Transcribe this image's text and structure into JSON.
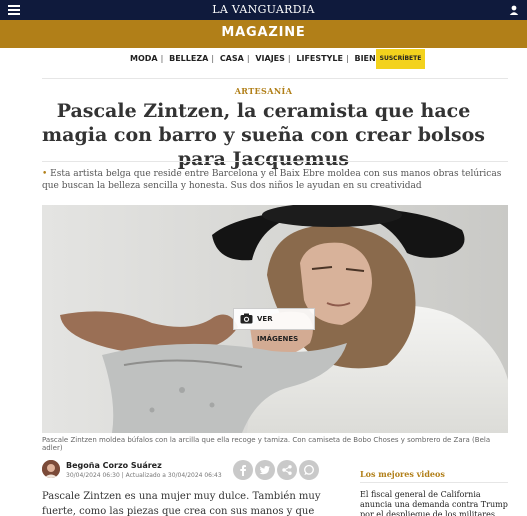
{
  "header": {
    "brand": "LA VANGUARDIA",
    "section_title": "MAGAZINE"
  },
  "nav": {
    "items": [
      "MODA",
      "BELLEZA",
      "CASA",
      "VIAJES",
      "LIFESTYLE",
      "BIENESTAR"
    ],
    "separator": "|",
    "subscribe_label": "SUSCRÍBETE"
  },
  "article": {
    "section": "ARTESANÍA",
    "headline": "Pascale Zintzen, la ceramista que hace magia con barro y sueña con crear bolsos para Jacquemus",
    "summary": "Esta artista belga que reside entre Barcelona y el Baix Ebre moldea con sus manos obras telúricas que buscan la belleza sencilla y honesta. Sus dos niños le ayudan en su creatividad",
    "gallery_button": "VER IMÁGENES",
    "caption": "Pascale Zintzen moldea búfalos con la arcilla que ella recoge y tamiza. Con camiseta de Bobo Choses y sombrero de Zara (Bela adler)",
    "author": "Begoña Corzo Suárez",
    "dates": "30/04/2024 06:30 | Actualizado a 30/04/2024 06:43",
    "body": "Pascale Zintzen es una mujer muy dulce. También muy fuerte, como las piezas que crea con sus manos y que tienen la textura"
  },
  "sidebar": {
    "heading": "Los mejores videos",
    "headline": "El fiscal general de California anuncia una demanda contra Trump por el despliegue de los militares"
  },
  "colors": {
    "navy": "#0f1a3c",
    "gold": "#b17f18",
    "subscribe": "#f3d21d"
  },
  "icons": [
    "menu-icon",
    "user-icon",
    "camera-icon",
    "facebook-icon",
    "twitter-icon",
    "share-icon",
    "whatsapp-icon"
  ]
}
